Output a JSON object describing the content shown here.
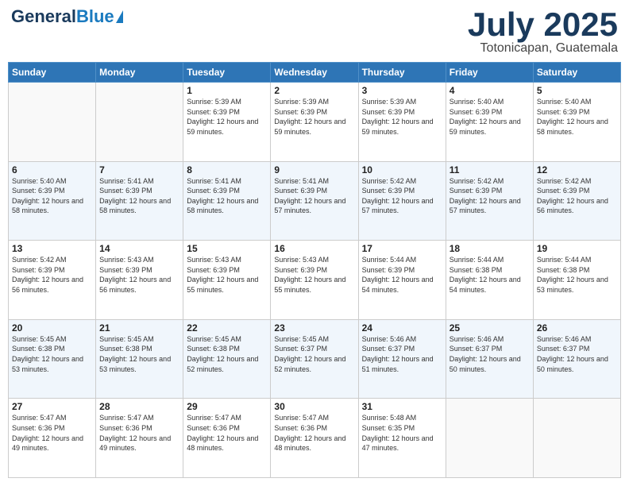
{
  "header": {
    "logo_general": "General",
    "logo_blue": "Blue",
    "month": "July 2025",
    "location": "Totonicapan, Guatemala"
  },
  "days_of_week": [
    "Sunday",
    "Monday",
    "Tuesday",
    "Wednesday",
    "Thursday",
    "Friday",
    "Saturday"
  ],
  "weeks": [
    [
      {
        "day": "",
        "sunrise": "",
        "sunset": "",
        "daylight": ""
      },
      {
        "day": "",
        "sunrise": "",
        "sunset": "",
        "daylight": ""
      },
      {
        "day": "1",
        "sunrise": "Sunrise: 5:39 AM",
        "sunset": "Sunset: 6:39 PM",
        "daylight": "Daylight: 12 hours and 59 minutes."
      },
      {
        "day": "2",
        "sunrise": "Sunrise: 5:39 AM",
        "sunset": "Sunset: 6:39 PM",
        "daylight": "Daylight: 12 hours and 59 minutes."
      },
      {
        "day": "3",
        "sunrise": "Sunrise: 5:39 AM",
        "sunset": "Sunset: 6:39 PM",
        "daylight": "Daylight: 12 hours and 59 minutes."
      },
      {
        "day": "4",
        "sunrise": "Sunrise: 5:40 AM",
        "sunset": "Sunset: 6:39 PM",
        "daylight": "Daylight: 12 hours and 59 minutes."
      },
      {
        "day": "5",
        "sunrise": "Sunrise: 5:40 AM",
        "sunset": "Sunset: 6:39 PM",
        "daylight": "Daylight: 12 hours and 58 minutes."
      }
    ],
    [
      {
        "day": "6",
        "sunrise": "Sunrise: 5:40 AM",
        "sunset": "Sunset: 6:39 PM",
        "daylight": "Daylight: 12 hours and 58 minutes."
      },
      {
        "day": "7",
        "sunrise": "Sunrise: 5:41 AM",
        "sunset": "Sunset: 6:39 PM",
        "daylight": "Daylight: 12 hours and 58 minutes."
      },
      {
        "day": "8",
        "sunrise": "Sunrise: 5:41 AM",
        "sunset": "Sunset: 6:39 PM",
        "daylight": "Daylight: 12 hours and 58 minutes."
      },
      {
        "day": "9",
        "sunrise": "Sunrise: 5:41 AM",
        "sunset": "Sunset: 6:39 PM",
        "daylight": "Daylight: 12 hours and 57 minutes."
      },
      {
        "day": "10",
        "sunrise": "Sunrise: 5:42 AM",
        "sunset": "Sunset: 6:39 PM",
        "daylight": "Daylight: 12 hours and 57 minutes."
      },
      {
        "day": "11",
        "sunrise": "Sunrise: 5:42 AM",
        "sunset": "Sunset: 6:39 PM",
        "daylight": "Daylight: 12 hours and 57 minutes."
      },
      {
        "day": "12",
        "sunrise": "Sunrise: 5:42 AM",
        "sunset": "Sunset: 6:39 PM",
        "daylight": "Daylight: 12 hours and 56 minutes."
      }
    ],
    [
      {
        "day": "13",
        "sunrise": "Sunrise: 5:42 AM",
        "sunset": "Sunset: 6:39 PM",
        "daylight": "Daylight: 12 hours and 56 minutes."
      },
      {
        "day": "14",
        "sunrise": "Sunrise: 5:43 AM",
        "sunset": "Sunset: 6:39 PM",
        "daylight": "Daylight: 12 hours and 56 minutes."
      },
      {
        "day": "15",
        "sunrise": "Sunrise: 5:43 AM",
        "sunset": "Sunset: 6:39 PM",
        "daylight": "Daylight: 12 hours and 55 minutes."
      },
      {
        "day": "16",
        "sunrise": "Sunrise: 5:43 AM",
        "sunset": "Sunset: 6:39 PM",
        "daylight": "Daylight: 12 hours and 55 minutes."
      },
      {
        "day": "17",
        "sunrise": "Sunrise: 5:44 AM",
        "sunset": "Sunset: 6:39 PM",
        "daylight": "Daylight: 12 hours and 54 minutes."
      },
      {
        "day": "18",
        "sunrise": "Sunrise: 5:44 AM",
        "sunset": "Sunset: 6:38 PM",
        "daylight": "Daylight: 12 hours and 54 minutes."
      },
      {
        "day": "19",
        "sunrise": "Sunrise: 5:44 AM",
        "sunset": "Sunset: 6:38 PM",
        "daylight": "Daylight: 12 hours and 53 minutes."
      }
    ],
    [
      {
        "day": "20",
        "sunrise": "Sunrise: 5:45 AM",
        "sunset": "Sunset: 6:38 PM",
        "daylight": "Daylight: 12 hours and 53 minutes."
      },
      {
        "day": "21",
        "sunrise": "Sunrise: 5:45 AM",
        "sunset": "Sunset: 6:38 PM",
        "daylight": "Daylight: 12 hours and 53 minutes."
      },
      {
        "day": "22",
        "sunrise": "Sunrise: 5:45 AM",
        "sunset": "Sunset: 6:38 PM",
        "daylight": "Daylight: 12 hours and 52 minutes."
      },
      {
        "day": "23",
        "sunrise": "Sunrise: 5:45 AM",
        "sunset": "Sunset: 6:37 PM",
        "daylight": "Daylight: 12 hours and 52 minutes."
      },
      {
        "day": "24",
        "sunrise": "Sunrise: 5:46 AM",
        "sunset": "Sunset: 6:37 PM",
        "daylight": "Daylight: 12 hours and 51 minutes."
      },
      {
        "day": "25",
        "sunrise": "Sunrise: 5:46 AM",
        "sunset": "Sunset: 6:37 PM",
        "daylight": "Daylight: 12 hours and 50 minutes."
      },
      {
        "day": "26",
        "sunrise": "Sunrise: 5:46 AM",
        "sunset": "Sunset: 6:37 PM",
        "daylight": "Daylight: 12 hours and 50 minutes."
      }
    ],
    [
      {
        "day": "27",
        "sunrise": "Sunrise: 5:47 AM",
        "sunset": "Sunset: 6:36 PM",
        "daylight": "Daylight: 12 hours and 49 minutes."
      },
      {
        "day": "28",
        "sunrise": "Sunrise: 5:47 AM",
        "sunset": "Sunset: 6:36 PM",
        "daylight": "Daylight: 12 hours and 49 minutes."
      },
      {
        "day": "29",
        "sunrise": "Sunrise: 5:47 AM",
        "sunset": "Sunset: 6:36 PM",
        "daylight": "Daylight: 12 hours and 48 minutes."
      },
      {
        "day": "30",
        "sunrise": "Sunrise: 5:47 AM",
        "sunset": "Sunset: 6:36 PM",
        "daylight": "Daylight: 12 hours and 48 minutes."
      },
      {
        "day": "31",
        "sunrise": "Sunrise: 5:48 AM",
        "sunset": "Sunset: 6:35 PM",
        "daylight": "Daylight: 12 hours and 47 minutes."
      },
      {
        "day": "",
        "sunrise": "",
        "sunset": "",
        "daylight": ""
      },
      {
        "day": "",
        "sunrise": "",
        "sunset": "",
        "daylight": ""
      }
    ]
  ]
}
